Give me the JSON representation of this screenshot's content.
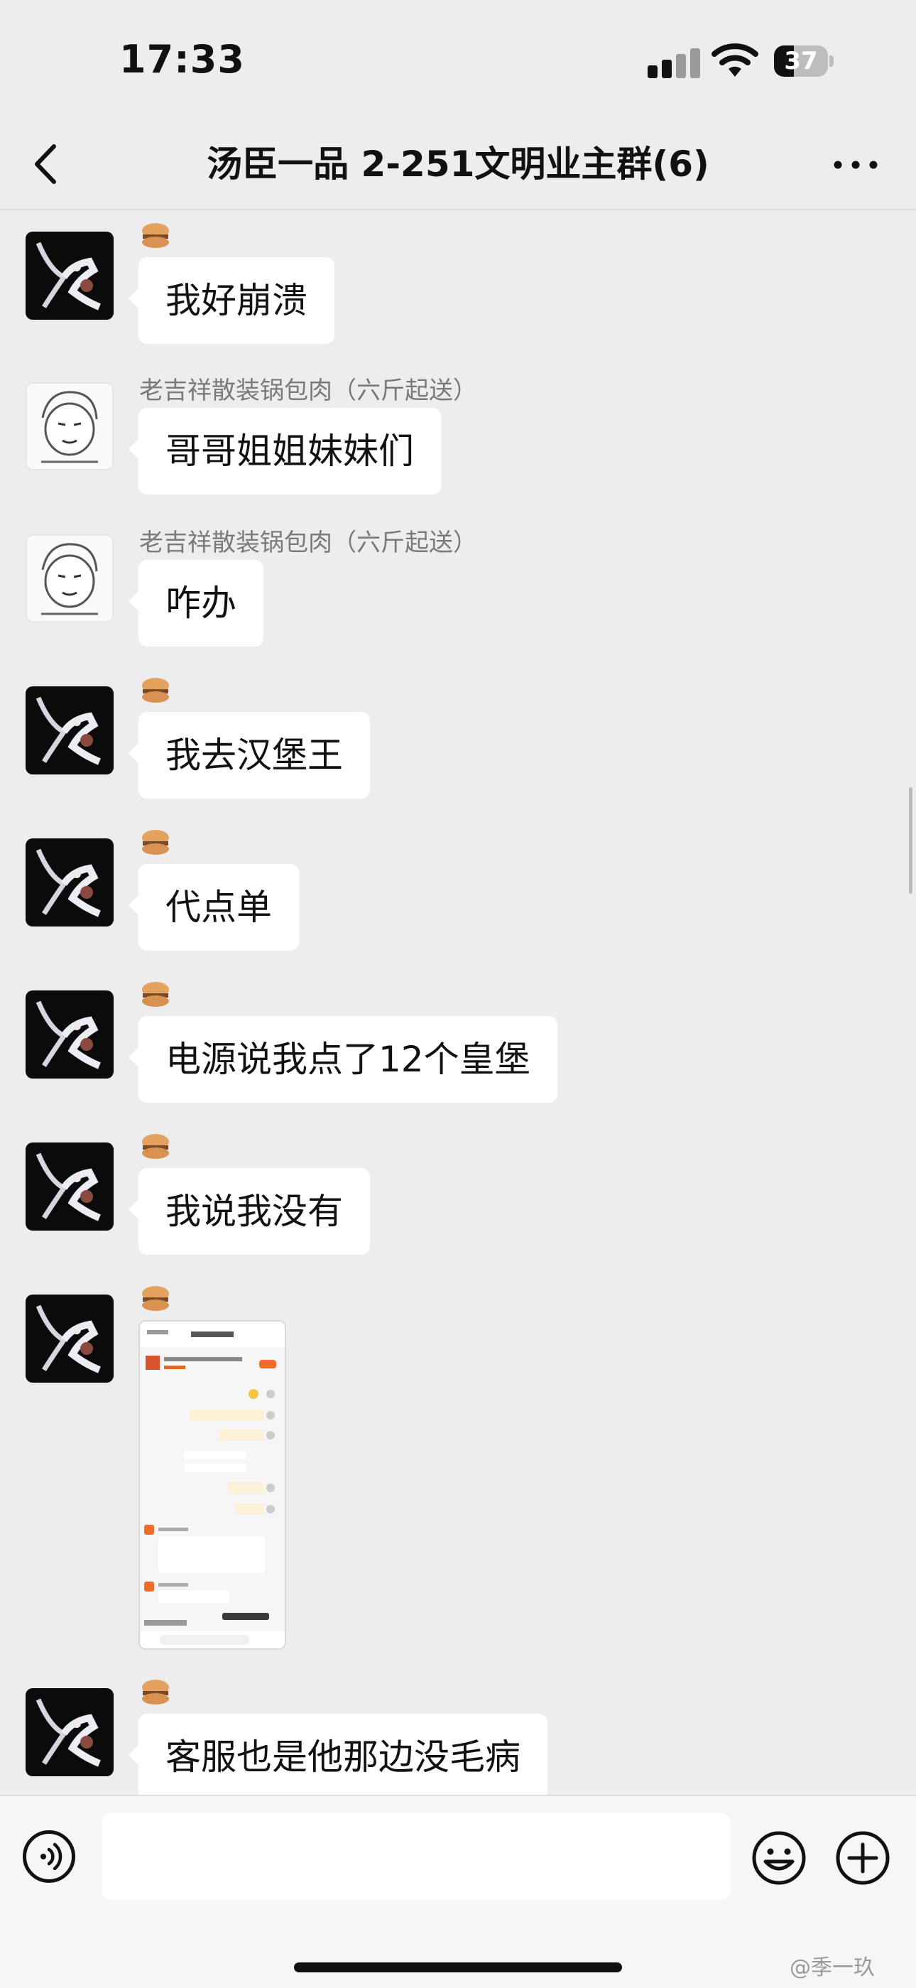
{
  "status": {
    "time": "17:33",
    "battery": "37",
    "battery_level": 0.37
  },
  "nav": {
    "title": "汤臣一品 2-251文明业主群(6)"
  },
  "messages": [
    {
      "sender": "me",
      "text": "我好崩溃"
    },
    {
      "sender": "laojixiang",
      "name": "老吉祥散装锅包肉（六斤起送）",
      "text": "哥哥姐姐妹妹们"
    },
    {
      "sender": "laojixiang",
      "name": "老吉祥散装锅包肉（六斤起送）",
      "text": "咋办"
    },
    {
      "sender": "me",
      "text": "我去汉堡王"
    },
    {
      "sender": "me",
      "text": "代点单"
    },
    {
      "sender": "me",
      "text": "电源说我点了12个皇堡"
    },
    {
      "sender": "me",
      "text": "我说我没有"
    },
    {
      "sender": "me",
      "type": "image",
      "image_alt": "聊天截图"
    },
    {
      "sender": "me",
      "text": "客服也是他那边没毛病"
    }
  ],
  "input": {
    "placeholder": ""
  },
  "watermark": "@季一玖",
  "colors": {
    "background": "#ededed",
    "bubble": "#ffffff",
    "nickname": "#7a7a7a"
  },
  "icons": {
    "back": "chevron-left-icon",
    "more": "more-dots-icon",
    "voice": "voice-icon",
    "emoji": "emoji-icon",
    "add": "plus-circle-icon"
  }
}
